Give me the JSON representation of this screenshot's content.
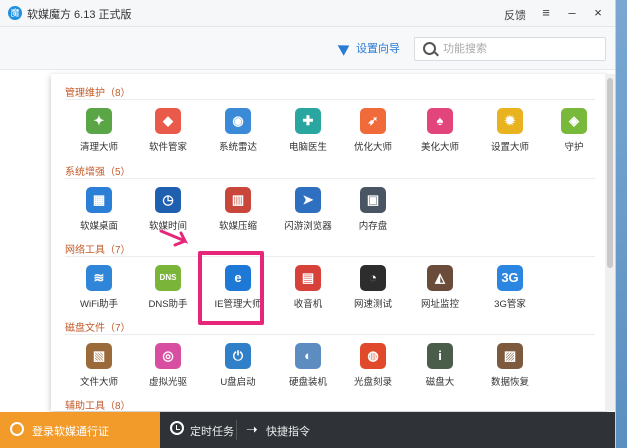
{
  "window": {
    "title": "软媒魔方 6.13 正式版",
    "logo_text": "魔",
    "feedback_label": "反馈",
    "menu_icon": "≡",
    "minimize_icon": "–",
    "close_icon": "×"
  },
  "toolbar": {
    "wizard_label": "设置向导",
    "search_placeholder": "功能搜索"
  },
  "sections": [
    {
      "header": "管理维护（8）",
      "tools": [
        {
          "label": "清理大师",
          "icon": "broom-icon",
          "color": "#5aa546",
          "glyph": "✦"
        },
        {
          "label": "软件管家",
          "icon": "software-manager-icon",
          "color": "#ea5a4a",
          "glyph": "◆"
        },
        {
          "label": "系统雷达",
          "icon": "radar-icon",
          "color": "#3a8ad8",
          "glyph": "◉"
        },
        {
          "label": "电脑医生",
          "icon": "doctor-icon",
          "color": "#2aa6a0",
          "glyph": "✚"
        },
        {
          "label": "优化大师",
          "icon": "rocket-icon",
          "color": "#f06a3a",
          "glyph": "➶"
        },
        {
          "label": "美化大师",
          "icon": "shirt-icon",
          "color": "#e2457c",
          "glyph": "♠"
        },
        {
          "label": "设置大师",
          "icon": "settings-icon",
          "color": "#e9b21f",
          "glyph": "✹"
        },
        {
          "label": "守护",
          "icon": "shield-icon",
          "color": "#78b83a",
          "glyph": "◈"
        }
      ]
    },
    {
      "header": "系统增强（5）",
      "tools": [
        {
          "label": "软媒桌面",
          "icon": "desktop-icon",
          "color": "#2b7fd6",
          "glyph": "▦"
        },
        {
          "label": "软媒时间",
          "icon": "time-icon",
          "color": "#1f5fb0",
          "glyph": "◷"
        },
        {
          "label": "软媒压缩",
          "icon": "compress-icon",
          "color": "#c9463a",
          "glyph": "▥"
        },
        {
          "label": "闪游浏览器",
          "icon": "browser-icon",
          "color": "#2f6fbf",
          "glyph": "➤"
        },
        {
          "label": "内存盘",
          "icon": "ramdisk-icon",
          "color": "#4a5563",
          "glyph": "▣"
        }
      ]
    },
    {
      "header": "网络工具（7）",
      "tools": [
        {
          "label": "WiFi助手",
          "icon": "wifi-icon",
          "color": "#2f86d8",
          "glyph": "≋"
        },
        {
          "label": "DNS助手",
          "icon": "dns-icon",
          "color": "#7ab53a",
          "glyph": "DNS"
        },
        {
          "label": "IE管理大师",
          "icon": "ie-icon",
          "color": "#1e78d6",
          "glyph": "e"
        },
        {
          "label": "收音机",
          "icon": "radio-icon",
          "color": "#d8413a",
          "glyph": "▤"
        },
        {
          "label": "网速测试",
          "icon": "speed-test-icon",
          "color": "#2d2d2d",
          "glyph": "◔"
        },
        {
          "label": "网址监控",
          "icon": "spy-icon",
          "color": "#6b4b3a",
          "glyph": "◭"
        },
        {
          "label": "3G管家",
          "icon": "3g-icon",
          "color": "#2a86e0",
          "glyph": "3G"
        }
      ]
    },
    {
      "header": "磁盘文件（7）",
      "tools": [
        {
          "label": "文件大师",
          "icon": "file-master-icon",
          "color": "#9a6a3a",
          "glyph": "▧"
        },
        {
          "label": "虚拟光驱",
          "icon": "virtual-drive-icon",
          "color": "#d84ea0",
          "glyph": "◎"
        },
        {
          "label": "U盘启动",
          "icon": "usb-boot-icon",
          "color": "#2f7fc9",
          "glyph": "⏻"
        },
        {
          "label": "硬盘装机",
          "icon": "hdd-install-icon",
          "color": "#5c8cc0",
          "glyph": "◐"
        },
        {
          "label": "光盘刻录",
          "icon": "burn-icon",
          "color": "#e04a2a",
          "glyph": "◍"
        },
        {
          "label": "磁盘大",
          "icon": "disk-icon",
          "color": "#4a5d4a",
          "glyph": "i"
        },
        {
          "label": "数据恢复",
          "icon": "data-recovery-icon",
          "color": "#7d5a3e",
          "glyph": "▨"
        }
      ]
    },
    {
      "header": "辅助工具（8）",
      "tools": []
    }
  ],
  "bottom": {
    "login_label": "登录软媒通行证",
    "scheduled_label": "定时任务",
    "quick_label": "快捷指令"
  }
}
